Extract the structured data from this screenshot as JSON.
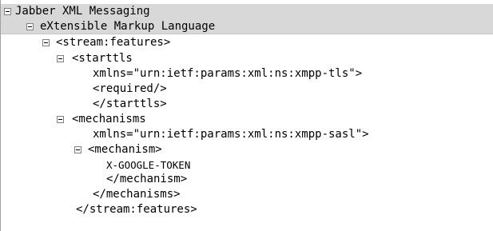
{
  "tree": {
    "nodes": [
      {
        "text": "Jabber XML Messaging",
        "expanded": true
      },
      {
        "text": "eXtensible Markup Language",
        "expanded": true
      },
      {
        "text": "<stream:features>",
        "expanded": true
      },
      {
        "text": "<starttls",
        "expanded": true
      },
      {
        "text": "xmlns=\"urn:ietf:params:xml:ns:xmpp-tls\">"
      },
      {
        "text": "<required/>"
      },
      {
        "text": "</starttls>"
      },
      {
        "text": "<mechanisms",
        "expanded": true
      },
      {
        "text": "xmlns=\"urn:ietf:params:xml:ns:xmpp-sasl\">"
      },
      {
        "text": "<mechanism>",
        "expanded": true
      },
      {
        "text": "X-GOOGLE-TOKEN"
      },
      {
        "text": "</mechanism>"
      },
      {
        "text": "</mechanisms>"
      },
      {
        "text": "</stream:features>"
      }
    ]
  }
}
